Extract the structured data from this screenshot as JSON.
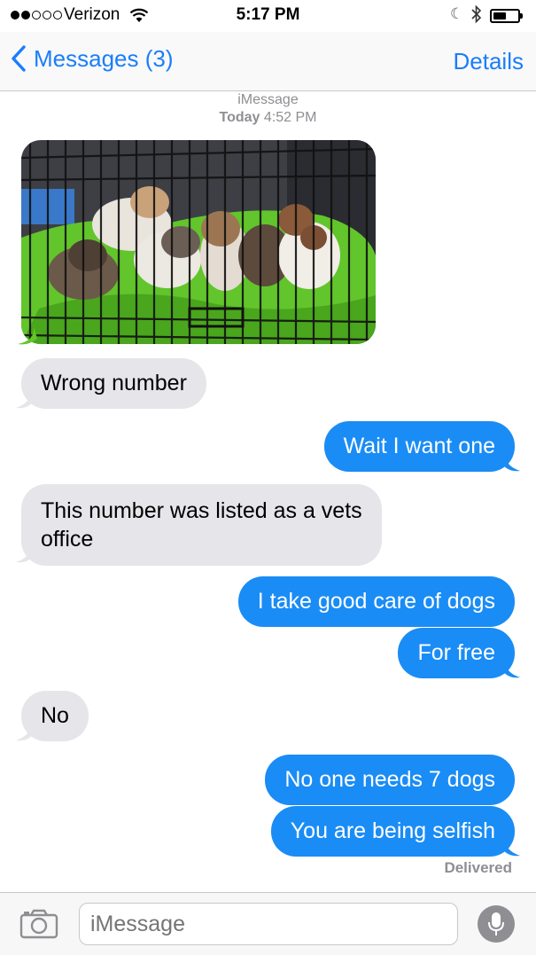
{
  "status_bar": {
    "carrier": "Verizon",
    "time": "5:17 PM",
    "signal_bars_filled": 2,
    "signal_bars_total": 5,
    "battery_level": 0.55,
    "icons": [
      "wifi-icon",
      "moon-icon",
      "bluetooth-icon",
      "battery-icon"
    ]
  },
  "nav": {
    "back_label": "Messages (3)",
    "details_label": "Details"
  },
  "conversation": {
    "service": "iMessage",
    "date_label": "Today",
    "date_time": "4:52 PM",
    "photo_description_icon": "photo-attachment",
    "messages": [
      {
        "direction": "in",
        "text": "Wrong number"
      },
      {
        "direction": "out",
        "text": "Wait I want one"
      },
      {
        "direction": "in",
        "text": "This number was listed as a vets",
        "text2": "office"
      },
      {
        "direction": "out",
        "text": "I take good care of dogs"
      },
      {
        "direction": "out",
        "text": "For free"
      },
      {
        "direction": "in",
        "text": "No"
      },
      {
        "direction": "out",
        "text": "No one needs 7 dogs"
      },
      {
        "direction": "out",
        "text": "You are being selfish"
      }
    ],
    "status": "Delivered"
  },
  "input": {
    "placeholder": "iMessage"
  },
  "colors": {
    "accent": "#1a7efb",
    "outgoing_bubble": "#1a8cf5",
    "incoming_bubble": "#e5e5ea",
    "meta_text": "#8e8e93"
  }
}
